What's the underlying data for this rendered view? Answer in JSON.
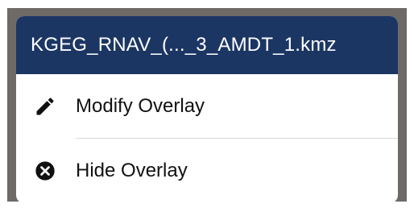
{
  "popup": {
    "title": "KGEG_RNAV_(..._3_AMDT_1.kmz",
    "items": [
      {
        "label": "Modify Overlay",
        "icon": "pencil-icon"
      },
      {
        "label": "Hide Overlay",
        "icon": "close-circle-icon"
      }
    ]
  },
  "colors": {
    "header_bg": "#1c3664",
    "header_text": "#ffffff",
    "item_text": "#111111"
  }
}
